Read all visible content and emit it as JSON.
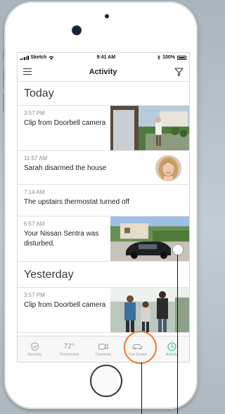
{
  "status_bar": {
    "carrier": "Sketch",
    "time": "9:41 AM",
    "battery": "100%"
  },
  "nav": {
    "title": "Activity"
  },
  "sections": [
    {
      "title": "Today",
      "items": [
        {
          "time": "3:57 PM",
          "message": "Clip from Doorbell camera"
        },
        {
          "time": "11:57 AM",
          "message": "Sarah disarmed the house"
        },
        {
          "time": "7:14 AM",
          "message": "The upstairs thermostat turned off"
        },
        {
          "time": "6:57 AM",
          "message": "Your Nissan Sentra was disturbed."
        }
      ]
    },
    {
      "title": "Yesterday",
      "items": [
        {
          "time": "3:57 PM",
          "message": "Clip from Doorbell camera"
        }
      ]
    }
  ],
  "tabs": [
    {
      "label": "Security",
      "icon": "shield-icon"
    },
    {
      "label": "Thermostat",
      "value": "72°",
      "icon": "thermostat-icon"
    },
    {
      "label": "Cameras",
      "icon": "camera-icon"
    },
    {
      "label": "Car Guard",
      "icon": "car-icon"
    },
    {
      "label": "Activity",
      "icon": "clock-icon"
    }
  ],
  "colors": {
    "accent": "#2cc4a1",
    "highlight": "#ef7b2c"
  }
}
